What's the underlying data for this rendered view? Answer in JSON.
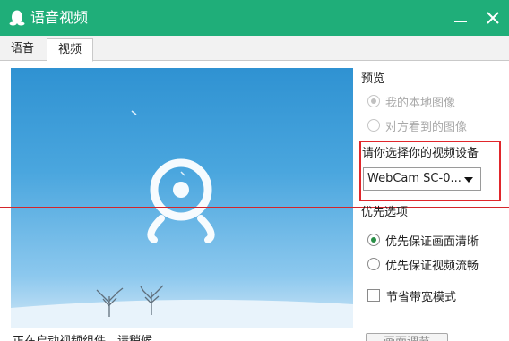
{
  "window": {
    "title": "语音视频",
    "accent_color": "#1fae79",
    "app_icon": "qq-penguin-icon",
    "minimize_icon": "minimize-icon",
    "close_icon": "close-icon"
  },
  "tabs": [
    {
      "label": "语音",
      "selected": false
    },
    {
      "label": "视频",
      "selected": true
    }
  ],
  "preview": {
    "icon": "webcam-icon",
    "status_text": "正在启动视频组件，请稍候..."
  },
  "panel": {
    "preview_heading": "预览",
    "preview_options": [
      {
        "label": "我的本地图像",
        "checked": true,
        "enabled": false
      },
      {
        "label": "对方看到的图像",
        "checked": false,
        "enabled": false
      }
    ],
    "device_heading": "请你选择你的视频设备",
    "device_select_value": "WebCam SC-0...",
    "priority_heading": "优先选项",
    "priority_options": [
      {
        "label": "优先保证画面清晰",
        "checked": true
      },
      {
        "label": "优先保证视频流畅",
        "checked": false
      }
    ],
    "bandwidth_label": "节省带宽模式",
    "bandwidth_checked": false,
    "bottom_button": "画面调节"
  },
  "annotation": {
    "highlight_color": "#e0262b"
  }
}
